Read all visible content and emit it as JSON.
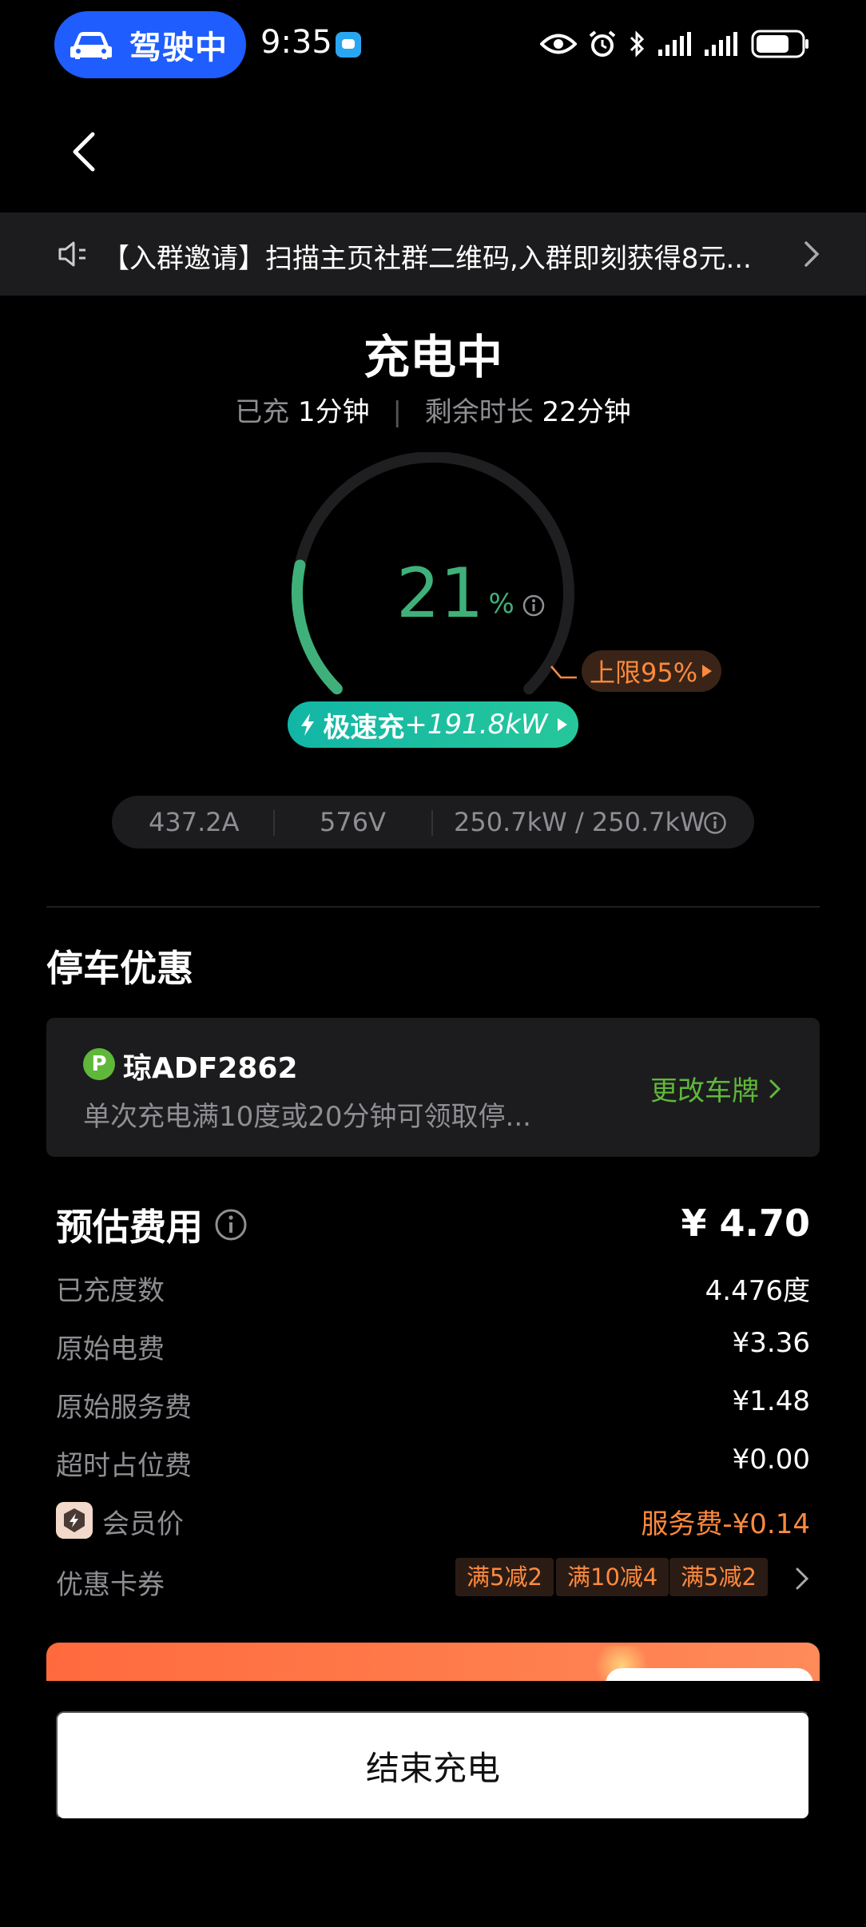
{
  "status_bar": {
    "driving_label": "驾驶中",
    "time": "9:35"
  },
  "notice": {
    "text": "【入群邀请】扫描主页社群二维码,入群即刻获得8元..."
  },
  "charging": {
    "title": "充电中",
    "elapsed_label": "已充",
    "elapsed_value": "1分钟",
    "remaining_label": "剩余时长",
    "remaining_value": "22分钟",
    "percent": "21",
    "percent_sign": "%",
    "percent_fraction": 0.21,
    "limit_label": "上限95%",
    "fast_label": "极速充",
    "fast_power": "+191.8kW",
    "current": "437.2A",
    "voltage": "576V",
    "power": "250.7kW / 250.7kW",
    "colors": {
      "progress": "#3fb07a",
      "limit": "#ff8a3d",
      "fast_start": "#12b6a6",
      "fast_end": "#27c79b"
    }
  },
  "parking": {
    "title": "停车优惠",
    "p_icon": "P",
    "plate": "琼ADF2862",
    "description": "单次充电满10度或20分钟可领取停...",
    "change_label": "更改车牌"
  },
  "fees": {
    "title": "预估费用",
    "total": "¥ 4.70",
    "rows": [
      {
        "label": "已充度数",
        "value": "4.476度"
      },
      {
        "label": "原始电费",
        "value": "¥3.36"
      },
      {
        "label": "原始服务费",
        "value": "¥1.48"
      },
      {
        "label": "超时占位费",
        "value": "¥0.00"
      }
    ],
    "member_label": "会员价",
    "member_value": "服务费-¥0.14",
    "coupon_label": "优惠卡券",
    "coupons": [
      "满5减2",
      "满10减4",
      "满5减2"
    ]
  },
  "actions": {
    "end_label": "结束充电"
  }
}
